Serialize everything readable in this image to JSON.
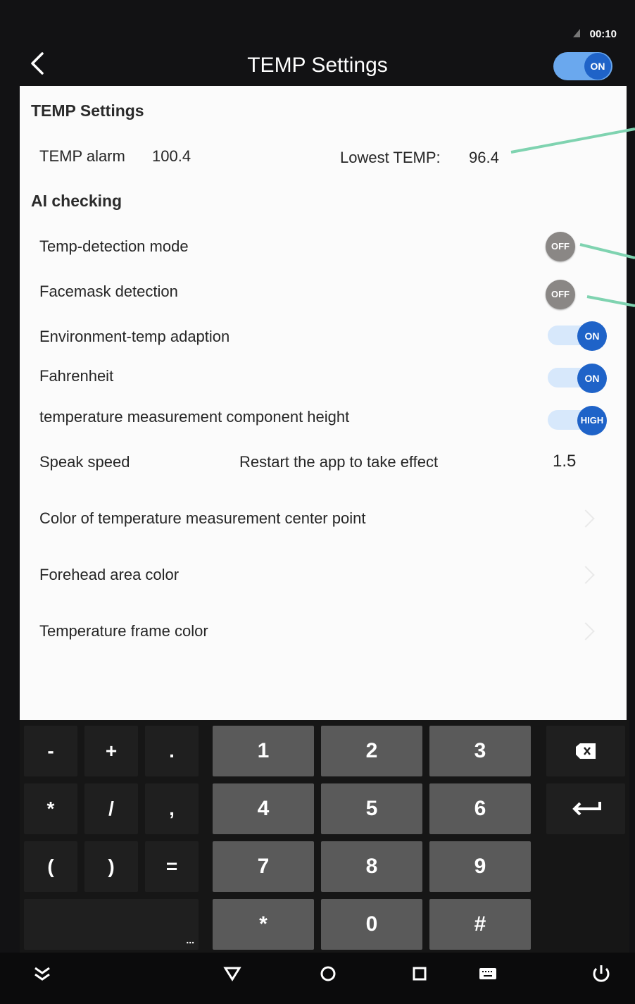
{
  "status_bar": {
    "time": "00:10"
  },
  "header": {
    "title": "TEMP Settings",
    "master_toggle": "ON"
  },
  "settings": {
    "section_temp": "TEMP Settings",
    "temp_alarm_label": "TEMP alarm",
    "temp_alarm_value": "100.4",
    "lowest_temp_label": "Lowest TEMP:",
    "lowest_temp_value": "96.4",
    "section_ai": "AI checking",
    "rows": [
      {
        "label": "Temp-detection mode",
        "state": "OFF"
      },
      {
        "label": "Facemask detection",
        "state": "OFF"
      },
      {
        "label": "Environment-temp adaption",
        "state": "ON"
      },
      {
        "label": "Fahrenheit",
        "state": "ON"
      },
      {
        "label": "temperature measurement component height",
        "state": "HIGH"
      }
    ],
    "speak_speed_label": "Speak speed",
    "speak_speed_note": "Restart the app to take effect",
    "speak_speed_value": "1.5",
    "color_rows": [
      {
        "label": "Color of temperature measurement center point"
      },
      {
        "label": "Forehead area color"
      },
      {
        "label": "Temperature frame color"
      }
    ]
  },
  "keyboard": {
    "symbols": [
      [
        "-",
        "+",
        "."
      ],
      [
        "*",
        "/",
        ","
      ],
      [
        "(",
        ")",
        "="
      ]
    ],
    "numbers": [
      [
        "1",
        "2",
        "3"
      ],
      [
        "4",
        "5",
        "6"
      ],
      [
        "7",
        "8",
        "9"
      ],
      [
        "*",
        "0",
        "#"
      ]
    ],
    "more": "..."
  },
  "colors": {
    "accent": "#1f63c8",
    "accent_light": "#6aa8ee",
    "off": "#8a8785",
    "annotation": "#7fd3b0"
  },
  "icons": {
    "back": "chevron-left-icon",
    "backspace": "backspace-icon",
    "enter": "enter-icon",
    "nav": [
      "collapse-icon",
      "back-triangle-icon",
      "home-icon",
      "recents-icon",
      "keyboard-icon",
      "power-icon"
    ]
  }
}
